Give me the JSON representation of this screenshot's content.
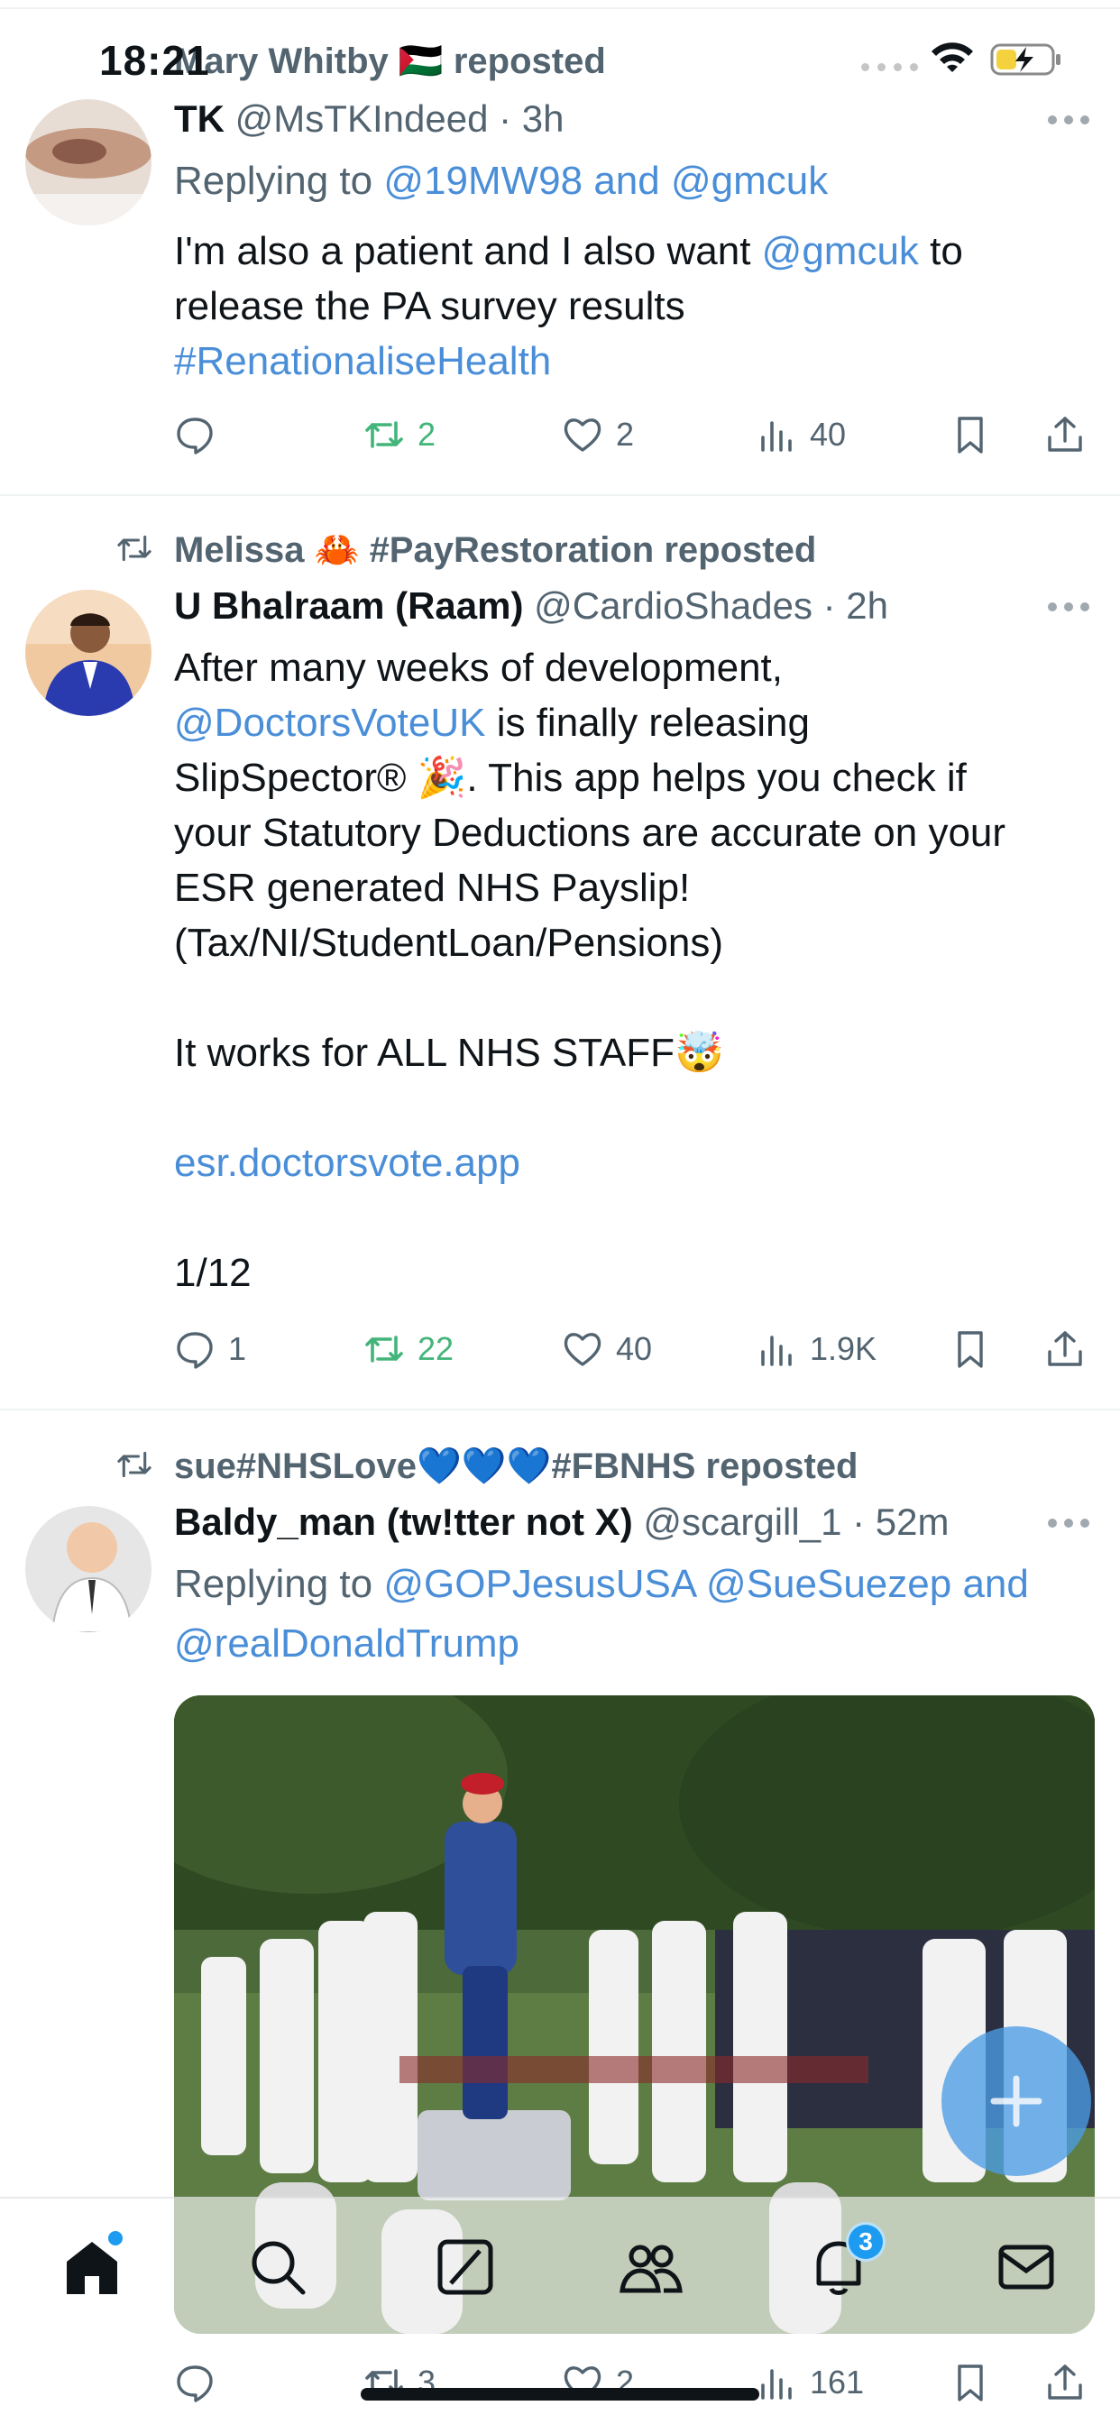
{
  "status_bar": {
    "time": "18:21"
  },
  "tweets": [
    {
      "repost_by": "Mary Whitby 🇵🇸 reposted",
      "name": "TK",
      "handle": "@MsTKIndeed",
      "time": "· 3h",
      "reply_prefix": "Replying to ",
      "reply_mentions": "@19MW98 and @gmcuk",
      "body": {
        "l1a": "I'm also a patient and I also want ",
        "l1m": "@gmcuk",
        "l1b": " to",
        "l2": "release the PA survey results",
        "l3": "#RenationaliseHealth"
      },
      "stats": {
        "replies": "",
        "reposts": "2",
        "likes": "2",
        "views": "40"
      }
    },
    {
      "repost_by": "Melissa 🦀 #PayRestoration reposted",
      "name": "U Bhalraam (Raam)",
      "handle": "@CardioShades",
      "time": "· 2h",
      "body": {
        "l1": "After many weeks of development,",
        "l2m": "@DoctorsVoteUK",
        "l2b": " is finally releasing",
        "l3": "SlipSpector® 🎉. This app helps you check if",
        "l4": "your Statutory Deductions are accurate on your",
        "l5": "ESR generated NHS Payslip!",
        "l6": "(Tax/NI/StudentLoan/Pensions)",
        "l7": "It works for ALL NHS STAFF🤯",
        "l8": "esr.doctorsvote.app",
        "l9": "1/12"
      },
      "stats": {
        "replies": "1",
        "reposts": "22",
        "likes": "40",
        "views": "1.9K"
      }
    },
    {
      "repost_by": "sue#NHSLove💙💙💙#FBNHS reposted",
      "name": "Baldy_man (tw!tter not X)",
      "handle": "@scargill_1",
      "time": "· 52m",
      "reply_prefix": "Replying to ",
      "reply_mentions_1": "@GOPJesusUSA @SueSuezep and",
      "reply_mentions_2": "@realDonaldTrump",
      "stats": {
        "replies": "",
        "reposts": "3",
        "likes": "2",
        "views": "161"
      }
    }
  ],
  "tab_bar": {
    "items": [
      "home-icon",
      "search-icon",
      "grok-icon",
      "communities-icon",
      "notifications-icon",
      "messages-icon"
    ],
    "notification_count": "3"
  },
  "colors": {
    "accent": "#1d9bf0",
    "link": "#4a8ed8",
    "repost_green": "#43b57a",
    "secondary": "#536471"
  }
}
